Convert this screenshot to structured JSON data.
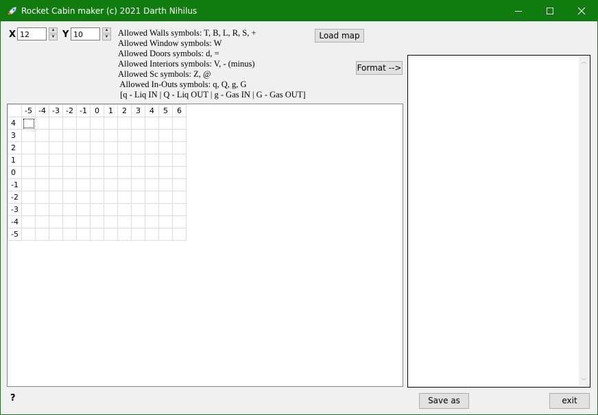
{
  "window": {
    "title": "Rocket Cabin maker (c) 2021 Darth Nihilus",
    "accent": "#107c10"
  },
  "dims": {
    "x_label": "X",
    "x_value": "12",
    "y_label": "Y",
    "y_value": "10"
  },
  "symbols": [
    "Allowed Walls symbols: T, B, L, R, S, +",
    "Allowed Window symbols: W",
    "Allowed Doors symbols: d, =",
    "Allowed Interiors symbols: V, - (minus)",
    "Allowed Sc symbols: Z, @",
    " Allowed In-Outs symbols: q, Q, g, G",
    " [q - Liq IN | Q - Liq OUT | g - Gas IN | G - Gas OUT]"
  ],
  "buttons": {
    "load_map": "Load map",
    "format": "Format -->",
    "save_as": "Save as",
    "exit": "exit",
    "help": "?"
  },
  "grid": {
    "columns": [
      "-5",
      "-4",
      "-3",
      "-2",
      "-1",
      "0",
      "1",
      "2",
      "3",
      "4",
      "5",
      "6"
    ],
    "rows": [
      "4",
      "3",
      "2",
      "1",
      "0",
      "-1",
      "-2",
      "-3",
      "-4",
      "-5"
    ]
  },
  "icons": {
    "app": "rocket-icon",
    "minimize": "minimize-icon",
    "maximize": "maximize-icon",
    "close": "close-icon"
  }
}
